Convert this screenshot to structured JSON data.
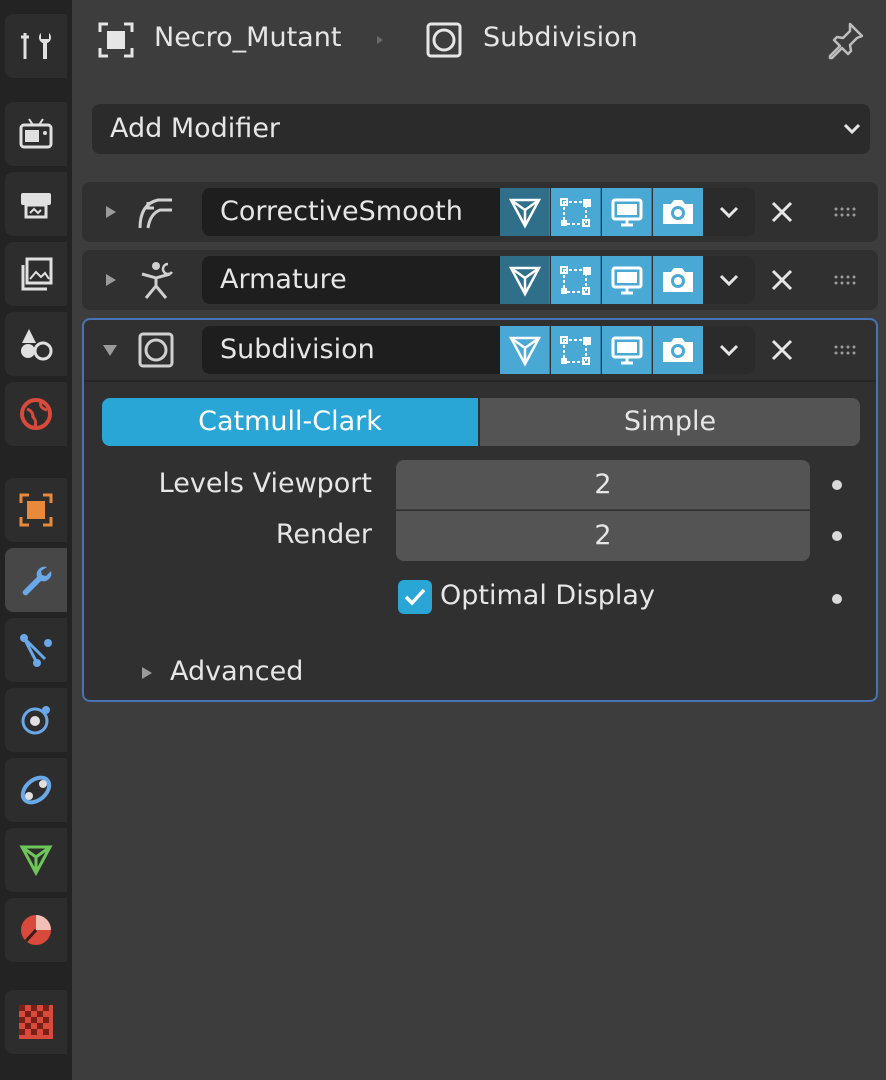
{
  "header": {
    "object_name": "Necro_Mutant",
    "modifier_name": "Subdivision"
  },
  "add_modifier": {
    "label": "Add Modifier"
  },
  "modifiers": [
    {
      "name": "CorrectiveSmooth",
      "expanded": false,
      "icon": "corrective-smooth-icon"
    },
    {
      "name": "Armature",
      "expanded": false,
      "icon": "armature-icon"
    },
    {
      "name": "Subdivision",
      "expanded": true,
      "icon": "subdivision-icon"
    }
  ],
  "subdivision": {
    "modes": [
      "Catmull-Clark",
      "Simple"
    ],
    "selected_mode": "Catmull-Clark",
    "levels_viewport_label": "Levels Viewport",
    "levels_viewport": "2",
    "render_label": "Render",
    "render": "2",
    "optimal_display_label": "Optimal Display",
    "optimal_display": true,
    "advanced_label": "Advanced"
  },
  "tabs": [
    "tool",
    "render",
    "output",
    "view-layer",
    "scene",
    "world",
    "object",
    "modifiers",
    "particles",
    "physics",
    "constraints",
    "data",
    "material",
    "texture"
  ],
  "active_tab": "modifiers",
  "colors": {
    "accent": "#29a6d6",
    "active_border": "#4772b3",
    "background": "#3d3d3d"
  }
}
